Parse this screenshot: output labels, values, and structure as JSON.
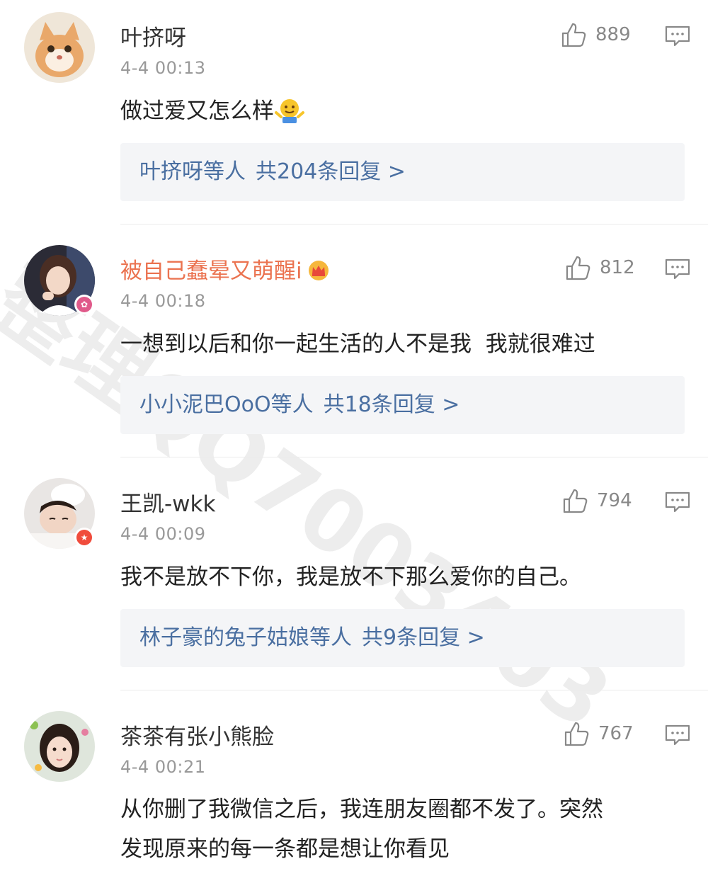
{
  "comments": [
    {
      "username": "叶挤呀",
      "time": "4-4 00:13",
      "likes": "889",
      "text": "做过爱又怎么样",
      "emoji": "shrug-emoji",
      "reply_names": "叶挤呀等人",
      "reply_total": "共204条回复 >"
    },
    {
      "username": "被自己蠢晕又萌醒i",
      "time": "4-4 00:18",
      "likes": "812",
      "text": "一想到以后和你一起生活的人不是我  我就很难过",
      "reply_names": "小小泥巴OoO等人",
      "reply_total": "共18条回复 >"
    },
    {
      "username": "王凯-wkk",
      "time": "4-4 00:09",
      "likes": "794",
      "text": "我不是放不下你，我是放不下那么爱你的自己。",
      "reply_names": "林子豪的兔子姑娘等人",
      "reply_total": "共9条回复 >"
    },
    {
      "username": "茶茶有张小熊脸",
      "time": "4-4 00:21",
      "likes": "767",
      "text_line1": "从你删了我微信之后，我连朋友圈都不发了。突然",
      "text_line2": "发现原来的每一条都是想让你看见"
    }
  ],
  "watermark": "整理QQ7003403",
  "colors": {
    "vip_name": "#eb7350",
    "reply_link": "#4a6fa1",
    "reply_bg": "#f4f5f7",
    "time": "#999999"
  },
  "icons": {
    "like": "thumbs-up-icon",
    "reply": "comment-icon",
    "vip": "vip-crown-icon"
  }
}
